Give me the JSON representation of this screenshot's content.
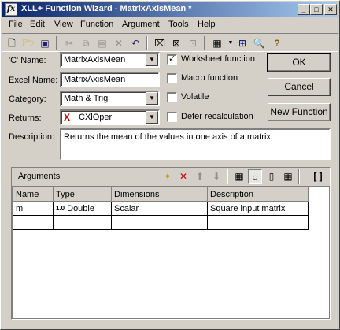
{
  "window": {
    "title": "XLL+ Function Wizard - MatrixAxisMean *",
    "app_icon": "fx",
    "minimize": "_",
    "maximize": "□",
    "close": "✕"
  },
  "menu": [
    {
      "label": "File"
    },
    {
      "label": "Edit"
    },
    {
      "label": "View"
    },
    {
      "label": "Function"
    },
    {
      "label": "Argument"
    },
    {
      "label": "Tools"
    },
    {
      "label": "Help"
    }
  ],
  "form": {
    "cname_label": "'C' Name:",
    "cname_value": "MatrixAxisMean",
    "excel_name_label": "Excel Name:",
    "excel_name_value": "MatrixAxisMean",
    "category_label": "Category:",
    "category_value": "Math & Trig",
    "returns_label": "Returns:",
    "returns_value": "CXlOper",
    "description_label": "Description:",
    "description_value": "Returns the mean of the values in one axis of a matrix"
  },
  "options": {
    "worksheet": {
      "label": "Worksheet function",
      "checked": true
    },
    "macro": {
      "label": "Macro function",
      "checked": false
    },
    "volatile": {
      "label": "Volatile",
      "checked": false
    },
    "defer": {
      "label": "Defer recalculation",
      "checked": false
    }
  },
  "buttons": {
    "ok": "OK",
    "cancel": "Cancel",
    "new_function": "New Function"
  },
  "arguments": {
    "header_label": "Arguments",
    "columns": [
      "Name",
      "Type",
      "Dimensions",
      "Description"
    ],
    "rows": [
      {
        "name": "m",
        "type_icon": "1.0",
        "type": "Double",
        "dimensions": "Scalar",
        "description": "Square input matrix"
      },
      {
        "name": "",
        "type_icon": "",
        "type": "",
        "dimensions": "",
        "description": ""
      }
    ]
  }
}
